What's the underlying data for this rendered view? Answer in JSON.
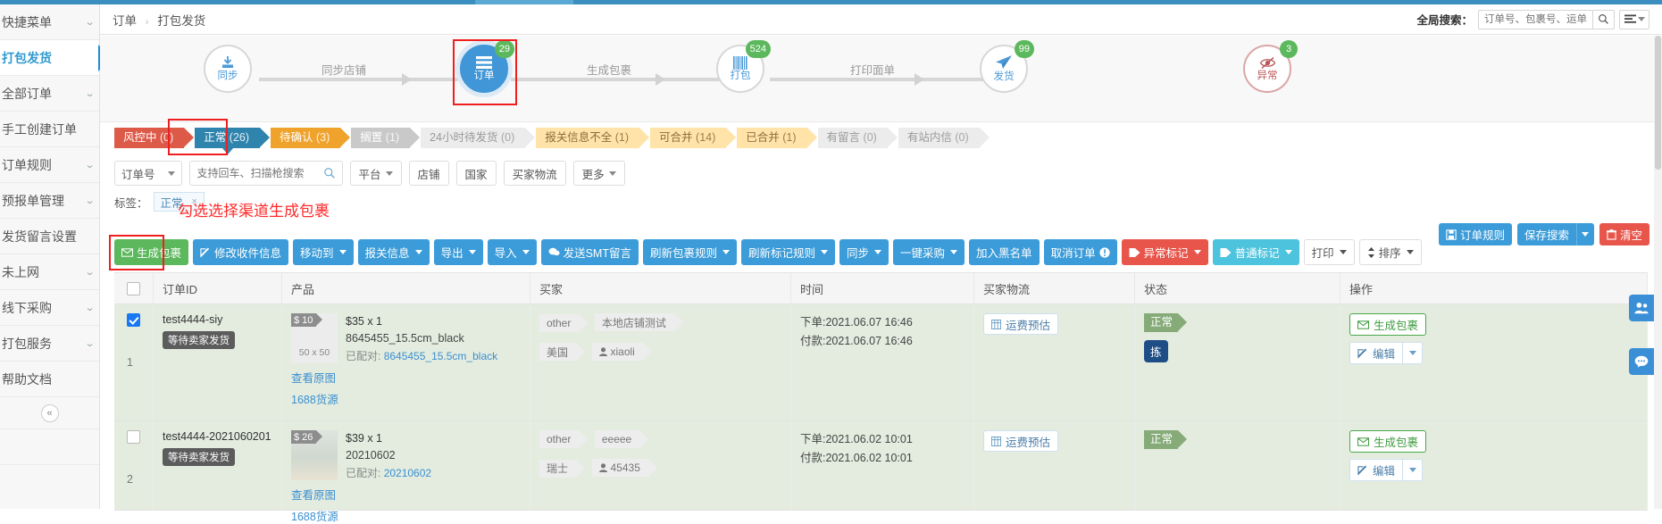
{
  "sidebar": {
    "items": [
      {
        "label": "快捷菜单",
        "chevron": "⌄",
        "active": false
      },
      {
        "label": "打包发货",
        "chevron": "",
        "active": true
      },
      {
        "label": "全部订单",
        "chevron": "⌄",
        "active": false
      },
      {
        "label": "手工创建订单",
        "chevron": "",
        "active": false
      },
      {
        "label": "订单规则",
        "chevron": "⌄",
        "active": false
      },
      {
        "label": "预报单管理",
        "chevron": "⌄",
        "active": false
      },
      {
        "label": "发货留言设置",
        "chevron": "",
        "active": false
      },
      {
        "label": "未上网",
        "chevron": "⌄",
        "active": false
      },
      {
        "label": "线下采购",
        "chevron": "⌄",
        "active": false
      },
      {
        "label": "打包服务",
        "chevron": "⌄",
        "active": false
      },
      {
        "label": "帮助文档",
        "chevron": "",
        "active": false
      }
    ],
    "collapse_icon": "«"
  },
  "header": {
    "breadcrumb_root": "订单",
    "breadcrumb_sep": "›",
    "breadcrumb_current": "打包发货",
    "global_search_label": "全局搜索：",
    "global_search_placeholder": "订单号、包裹号、运单号",
    "search_icon": "search-icon",
    "menu_icon": "list-menu-icon"
  },
  "stepper": {
    "steps": [
      {
        "label": "同步",
        "badge": "",
        "icon": "download-icon",
        "style": "outline"
      },
      {
        "label": "订单",
        "badge": "29",
        "icon": "orders-icon",
        "style": "blue",
        "highlighted": true
      },
      {
        "label": "打包",
        "badge": "524",
        "icon": "barcode-icon",
        "style": "outline"
      },
      {
        "label": "发货",
        "badge": "99",
        "icon": "paperplane-icon",
        "style": "outline"
      },
      {
        "label": "异常",
        "badge": "3",
        "icon": "exception-icon",
        "style": "error"
      }
    ],
    "captions": [
      "同步店铺",
      "生成包裹",
      "打印面单"
    ]
  },
  "tabs": [
    {
      "label": "风控中",
      "count": "(0)",
      "style": "red",
      "selected": false
    },
    {
      "label": "正常",
      "count": "(26)",
      "style": "blue",
      "selected": true
    },
    {
      "label": "待确认",
      "count": "(3)",
      "style": "orange",
      "selected": false
    },
    {
      "label": "搁置",
      "count": "(1)",
      "style": "gray",
      "selected": false
    },
    {
      "label": "24小时待发货",
      "count": "(0)",
      "style": "lgray",
      "selected": false
    },
    {
      "label": "报关信息不全",
      "count": "(1)",
      "style": "yellow",
      "selected": false
    },
    {
      "label": "可合并",
      "count": "(14)",
      "style": "yellow",
      "selected": false
    },
    {
      "label": "已合并",
      "count": "(1)",
      "style": "yellow",
      "selected": false
    },
    {
      "label": "有留言",
      "count": "(0)",
      "style": "lgray",
      "selected": false
    },
    {
      "label": "有站内信",
      "count": "(0)",
      "style": "lgray",
      "selected": false
    }
  ],
  "filters": {
    "field_select": "订单号",
    "search_placeholder": "支持回车、扫描枪搜索",
    "buttons": [
      {
        "label": "平台",
        "caret": true
      },
      {
        "label": "店铺",
        "caret": false
      },
      {
        "label": "国家",
        "caret": false
      },
      {
        "label": "买家物流",
        "caret": false
      },
      {
        "label": "更多",
        "caret": true
      }
    ]
  },
  "tagbar": {
    "label": "标签：",
    "chip": "正常",
    "chip_close": "×",
    "annotation": "勾选选择渠道生成包裹"
  },
  "right_actions": [
    {
      "label": "订单规则",
      "style": "blue",
      "icon": "save-icon"
    },
    {
      "label": "保存搜索",
      "style": "blue",
      "split": true
    },
    {
      "label": "清空",
      "style": "red",
      "icon": "trash-icon"
    }
  ],
  "toolbar": [
    {
      "label": "生成包裹",
      "style": "green",
      "icon": "envelope-icon",
      "caret": false,
      "highlighted": true
    },
    {
      "label": "修改收件信息",
      "style": "blue",
      "icon": "edit-icon",
      "caret": false
    },
    {
      "label": "移动到",
      "style": "blue",
      "icon": "",
      "caret": true
    },
    {
      "label": "报关信息",
      "style": "blue",
      "icon": "",
      "caret": true
    },
    {
      "label": "导出",
      "style": "blue",
      "icon": "",
      "caret": true
    },
    {
      "label": "导入",
      "style": "blue",
      "icon": "",
      "caret": true
    },
    {
      "label": "发送SMT留言",
      "style": "blue",
      "icon": "chat-icon",
      "caret": false
    },
    {
      "label": "刷新包裹规则",
      "style": "blue",
      "icon": "",
      "caret": true
    },
    {
      "label": "刷新标记规则",
      "style": "blue",
      "icon": "",
      "caret": true
    },
    {
      "label": "同步",
      "style": "blue",
      "icon": "",
      "caret": true
    },
    {
      "label": "一键采购",
      "style": "blue",
      "icon": "",
      "caret": true
    },
    {
      "label": "加入黑名单",
      "style": "blue",
      "icon": "",
      "caret": false
    },
    {
      "label": "取消订单",
      "style": "blue",
      "icon": "info-icon",
      "caret": false
    },
    {
      "label": "异常标记",
      "style": "red",
      "icon": "tag-icon",
      "caret": true
    },
    {
      "label": "普通标记",
      "style": "cyan",
      "icon": "tag-icon",
      "caret": true
    },
    {
      "label": "打印",
      "style": "white",
      "icon": "",
      "caret": true
    },
    {
      "label": "排序",
      "style": "white",
      "icon": "sort-icon",
      "caret": true
    }
  ],
  "table": {
    "columns": [
      "",
      "订单ID",
      "产品",
      "买家",
      "时间",
      "买家物流",
      "状态",
      "操作"
    ],
    "rows": [
      {
        "num": "1",
        "checked": true,
        "order_id": "test4444-siy",
        "order_status_pill": "等待卖家发货",
        "price_flag": "$ 10",
        "thumb_dim": "50 x 50",
        "qty": "$35 x 1",
        "sku": "8645455_15.5cm_black",
        "matched_label": "已配对:",
        "matched_value": "8645455_15.5cm_black",
        "link_view": "查看原图",
        "link_source": "1688货源",
        "buyer_chips": [
          "other",
          "本地店铺测试"
        ],
        "buyer_chips2": [
          "美国",
          "xiaoli"
        ],
        "time_order": "下单:2021.06.07 16:46",
        "time_pay": "付款:2021.06.07 16:46",
        "logistics_btn": "运费预估",
        "status_flag": "正常",
        "status_square": "拣",
        "action_primary": "生成包裹",
        "action_edit": "编辑"
      },
      {
        "num": "2",
        "checked": false,
        "order_id": "test4444-2021060201",
        "order_status_pill": "等待卖家发货",
        "price_flag": "$ 26",
        "thumb_dim": "",
        "qty": "$39 x 1",
        "sku": "20210602",
        "matched_label": "已配对:",
        "matched_value": "20210602",
        "link_view": "查看原图",
        "link_source": "1688货源",
        "buyer_chips": [
          "other",
          "eeeee"
        ],
        "buyer_chips2": [
          "瑞士",
          "45435"
        ],
        "time_order": "下单:2021.06.02 10:01",
        "time_pay": "付款:2021.06.02 10:01",
        "logistics_btn": "运费预估",
        "status_flag": "正常",
        "status_square": "",
        "action_primary": "生成包裹",
        "action_edit": "编辑"
      }
    ]
  },
  "float_buttons": [
    {
      "icon": "contacts-icon",
      "name": "contacts-float-button"
    },
    {
      "icon": "chat-icon",
      "name": "chat-float-button"
    }
  ],
  "colors": {
    "brand_blue": "#3b9cd9",
    "green": "#5cb85c",
    "red": "#e8554b",
    "annotation_red": "#ff2a2a",
    "row_green": "#e4ecdf"
  }
}
